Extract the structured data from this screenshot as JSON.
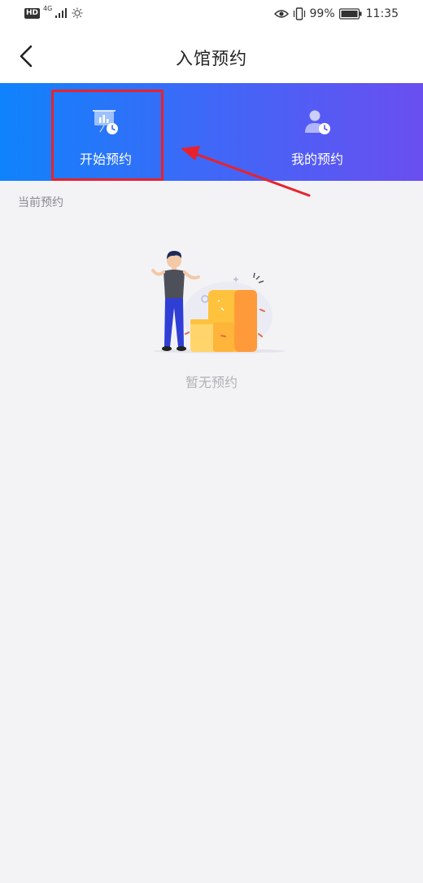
{
  "status_bar": {
    "hd": "HD",
    "network": "4G",
    "battery": "99%",
    "time": "11:35"
  },
  "nav": {
    "title": "入馆预约",
    "back_icon": "chevron-left-icon"
  },
  "banner": {
    "items": [
      {
        "label": "开始预约",
        "icon": "presentation-clock-icon"
      },
      {
        "label": "我的预约",
        "icon": "user-clock-icon"
      }
    ],
    "highlight_color": "#e8222c"
  },
  "content": {
    "section_title": "当前预约",
    "empty_text": "暂无预约"
  },
  "colors": {
    "gradient_start": "#0f83fb",
    "gradient_end": "#6a4ef0",
    "background": "#f3f3f6"
  }
}
